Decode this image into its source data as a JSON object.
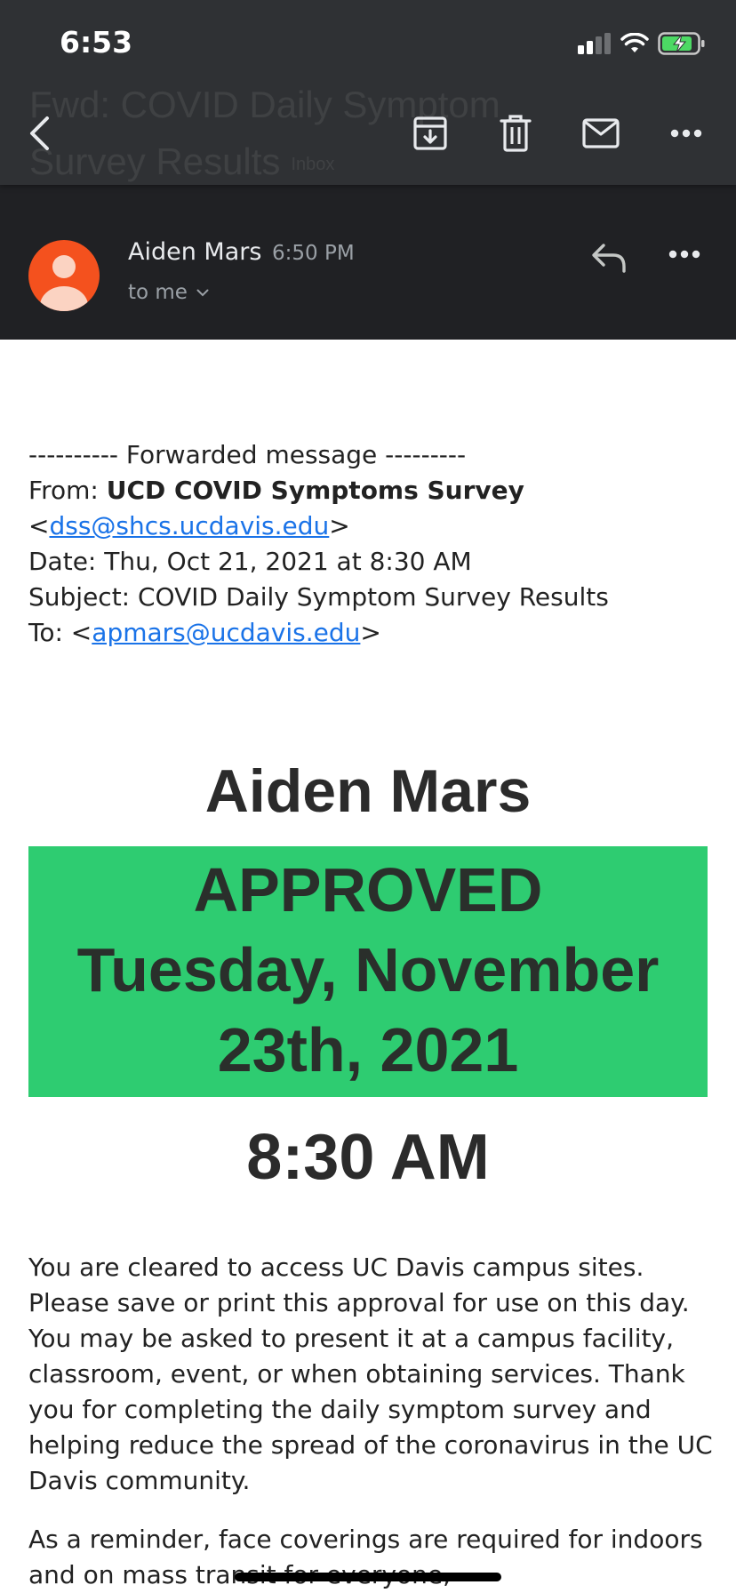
{
  "status_bar": {
    "time": "6:53"
  },
  "header": {
    "faded_subject": "Fwd: COVID Daily Symptom Survey Results",
    "faded_tag": "Inbox",
    "icons": [
      "back-arrow-icon",
      "archive-icon",
      "trash-icon",
      "mail-icon",
      "more-horizontal-icon"
    ]
  },
  "sender": {
    "name": "Aiden Mars",
    "time": "6:50 PM",
    "recipient": "to me"
  },
  "forwarded": {
    "divider": "---------- Forwarded message ---------",
    "from_label": "From: ",
    "from_name": "UCD COVID Symptoms Survey",
    "from_email_open": "<",
    "from_email": "dss@shcs.ucdavis.edu",
    "from_email_close": ">",
    "date": "Date: Thu, Oct 21, 2021 at 8:30 AM",
    "subject": "Subject: COVID Daily Symptom Survey Results",
    "to_label": "To: <",
    "to_email": "apmars@ucdavis.edu",
    "to_close": ">"
  },
  "approval": {
    "name": "Aiden Mars",
    "status": "APPROVED",
    "date_line1": "Tuesday, November",
    "date_line2": "23th, 2021",
    "time": "8:30 AM",
    "status_color": "#2ecc71"
  },
  "body": {
    "paragraph1": "You are cleared to access UC Davis campus sites. Please save or print this approval for use on this day. You may be asked to present it at a campus facility, classroom, event, or when obtaining services. Thank you for completing the daily symptom survey and helping reduce the spread of the coronavirus in the UC Davis community.",
    "paragraph2": "As a reminder, face coverings are required for indoors and on mass transit for everyone,"
  }
}
